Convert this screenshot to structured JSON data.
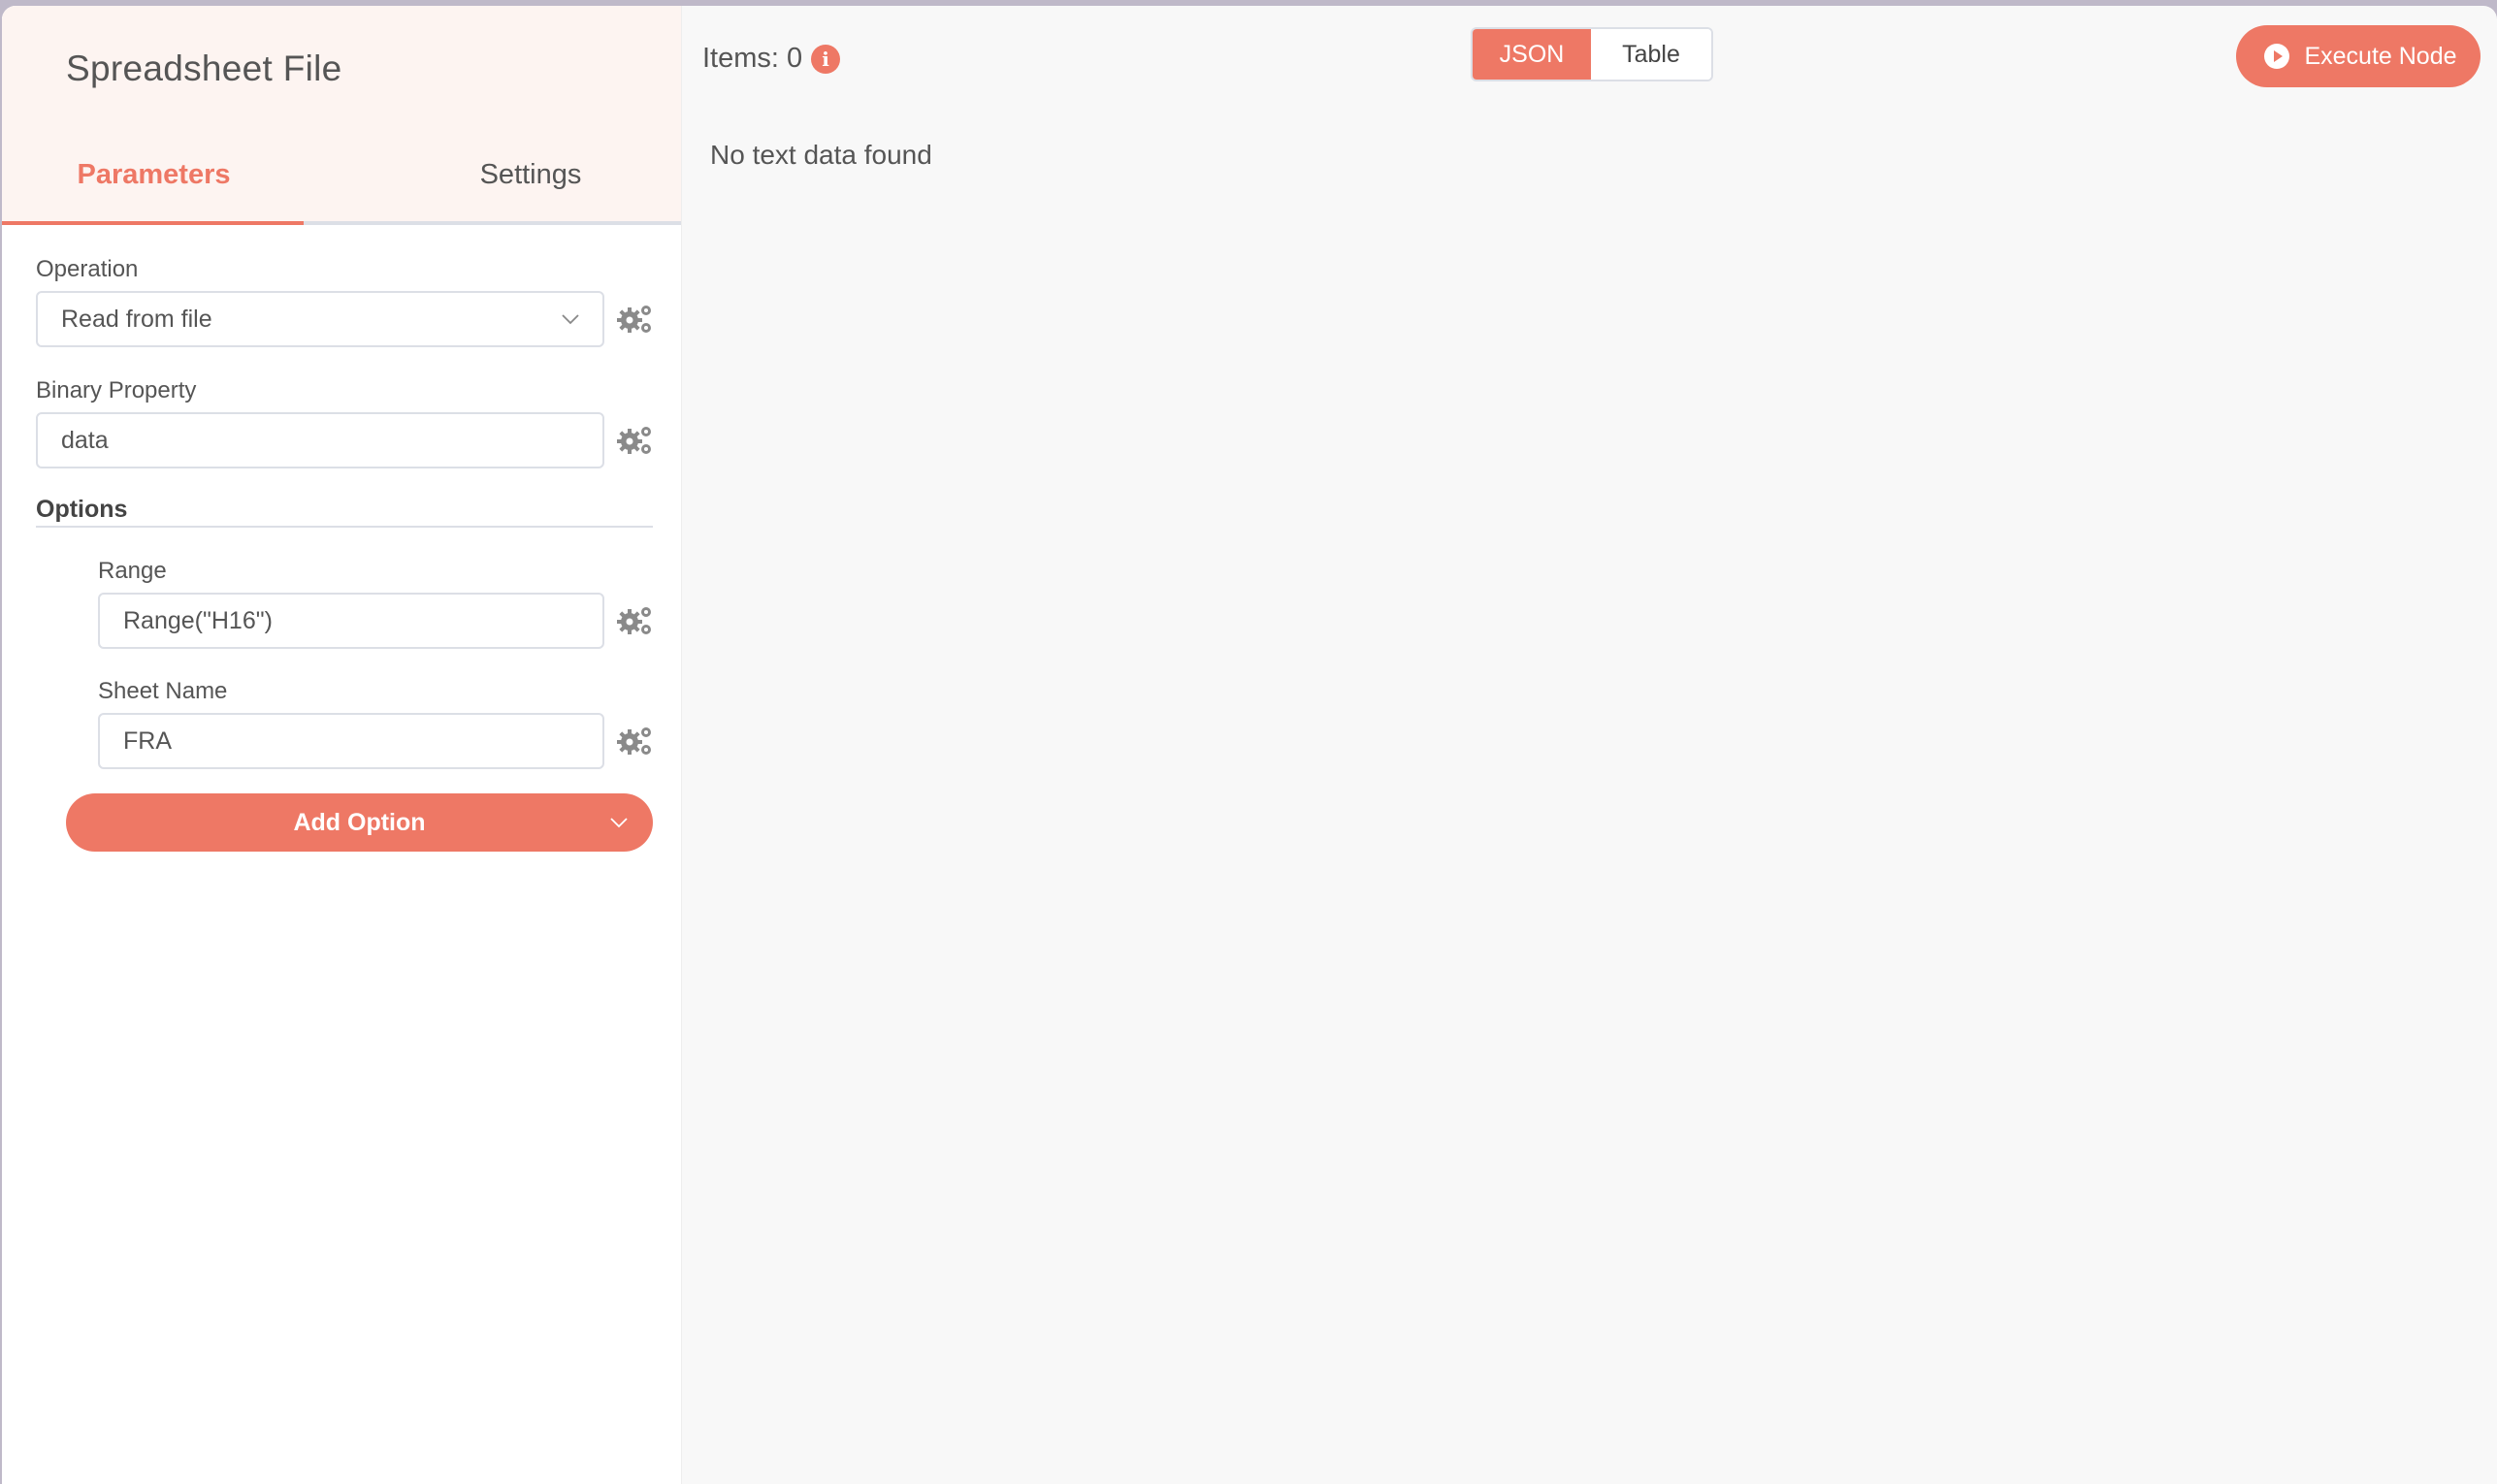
{
  "node": {
    "title": "Spreadsheet File"
  },
  "tabs": [
    {
      "label": "Parameters",
      "active": true
    },
    {
      "label": "Settings",
      "active": false
    }
  ],
  "parameters": {
    "operation": {
      "label": "Operation",
      "value": "Read from file"
    },
    "binary_property": {
      "label": "Binary Property",
      "value": "data"
    },
    "options": {
      "label": "Options",
      "range": {
        "label": "Range",
        "value": "Range(\"H16\")"
      },
      "sheet_name": {
        "label": "Sheet Name",
        "value": "FRA"
      },
      "add_option_label": "Add Option"
    }
  },
  "output": {
    "items_label": "Items: 0",
    "info_icon_glyph": "i",
    "view_modes": [
      {
        "label": "JSON",
        "active": true
      },
      {
        "label": "Table",
        "active": false
      }
    ],
    "execute_label": "Execute Node",
    "empty_message": "No text data found"
  },
  "colors": {
    "accent": "#ee7865",
    "header_bg": "#fdf4f1",
    "output_bg": "#f8f8f8"
  }
}
